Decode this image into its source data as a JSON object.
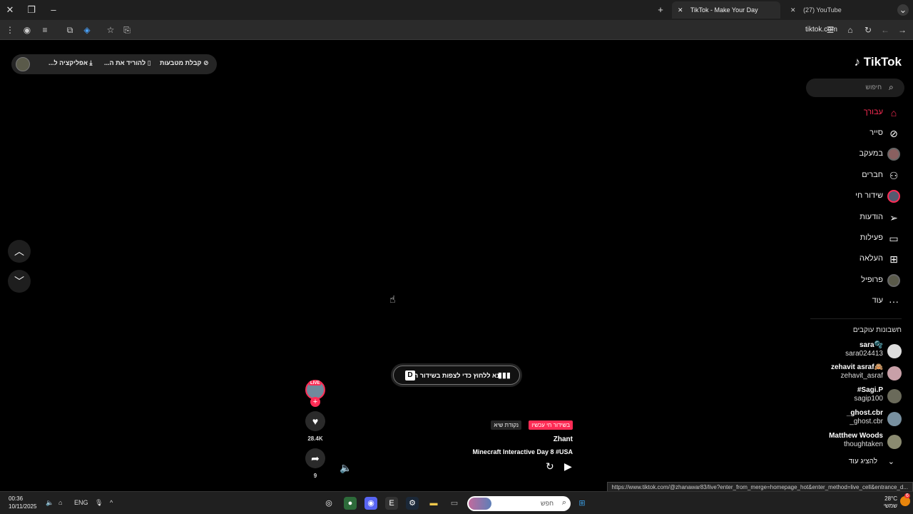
{
  "browser": {
    "tabs": [
      {
        "label": "TikTok - Make Your Day",
        "active": true
      },
      {
        "label": "(27) YouTube",
        "active": false
      }
    ],
    "url": "tiktok.com",
    "status_url": "https://www.tiktok.com/@zhanawar83/live?enter_from_merge=homepage_hot&enter_method=live_cell&entrance_d..."
  },
  "topbar": {
    "coins_label": "קבלת מטבעות",
    "download_label": "להוריד את ה...",
    "app_label": "אפליקציה ל..."
  },
  "sidebar": {
    "logo": "TikTok",
    "search_placeholder": "חיפוש",
    "items": [
      {
        "label": "עבורך",
        "icon": "home-icon",
        "active": true
      },
      {
        "label": "סייר",
        "icon": "compass-icon"
      },
      {
        "label": "במעקב",
        "icon": "following-avatar-icon"
      },
      {
        "label": "חברים",
        "icon": "friends-icon"
      },
      {
        "label": "שידור חי",
        "icon": "live-avatar-icon"
      },
      {
        "label": "הודעות",
        "icon": "send-icon"
      },
      {
        "label": "פעילות",
        "icon": "message-icon"
      },
      {
        "label": "העלאה",
        "icon": "upload-icon"
      },
      {
        "label": "פרופיל",
        "icon": "profile-avatar-icon"
      },
      {
        "label": "עוד",
        "icon": "more-icon"
      }
    ],
    "following_title": "חשבונות עוקבים",
    "accounts": [
      {
        "name": "sara🫧",
        "username": "sara024413"
      },
      {
        "name": "zehavit asraf🙈",
        "username": "zehavit_asraf"
      },
      {
        "name": "#Sagi.P",
        "username": "sagip100"
      },
      {
        "name": "_ghost.cbr",
        "username": "_ghost.cbr"
      },
      {
        "name": "Matthew Woods",
        "username": "thoughtaken"
      }
    ],
    "show_more": "להציג עוד"
  },
  "video": {
    "live_pill": "נא ללחוץ כדי לצפות בשידור החי",
    "live_pill_key": "D",
    "live_tag": "LIVE",
    "likes": "28.4K",
    "shares": "9",
    "badge_live": "בשידור חי עכשיו",
    "badge_gold": "נקודת שיא",
    "creator": "Zhant",
    "title": "Minecraft Interactive Day 8 #USA"
  },
  "taskbar": {
    "time": "00:36",
    "date": "10/11/2025",
    "lang": "ENG",
    "search_placeholder": "חפש",
    "weather_temp": "28°C",
    "weather_desc": "שמשי",
    "notif_count": "6"
  },
  "colors": {
    "accent": "#fe2c55"
  }
}
